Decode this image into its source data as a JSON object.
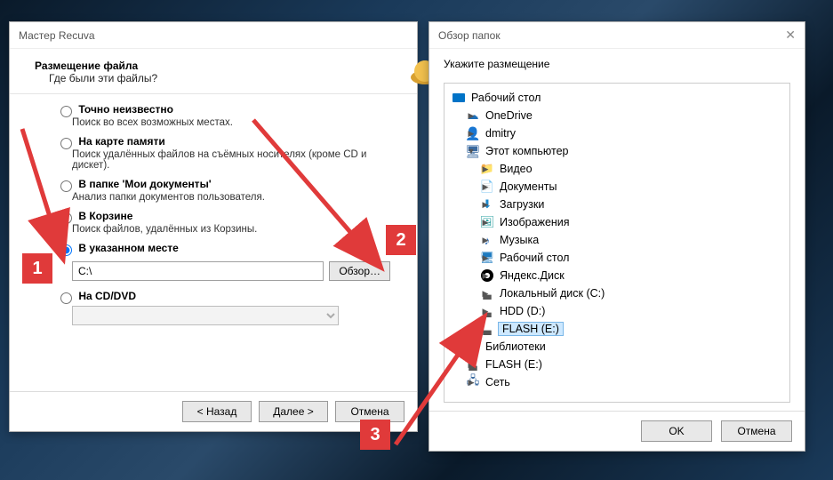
{
  "wizard": {
    "title": "Мастер Recuva",
    "head_title": "Размещение файла",
    "head_subtitle": "Где были эти файлы?",
    "options": {
      "unknown": {
        "label": "Точно неизвестно",
        "desc": "Поиск во всех возможных местах."
      },
      "card": {
        "label": "На карте памяти",
        "desc": "Поиск удалённых файлов на съёмных носителях (кроме CD и дискет)."
      },
      "mydocs": {
        "label": "В папке 'Мои документы'",
        "desc": "Анализ папки документов пользователя."
      },
      "recycle": {
        "label": "В Корзине",
        "desc": "Поиск файлов, удалённых из Корзины."
      },
      "specified": {
        "label": "В указанном месте"
      },
      "cddvd": {
        "label": "На CD/DVD"
      }
    },
    "path_value": "C:\\",
    "browse_label": "Обзор…",
    "footer": {
      "back": "< Назад",
      "next": "Далее >",
      "cancel": "Отмена"
    }
  },
  "dialog": {
    "title": "Обзор папок",
    "prompt": "Укажите размещение",
    "tree": [
      {
        "indent": 0,
        "arrow": "none",
        "icon": "desktop",
        "label": "Рабочий стол"
      },
      {
        "indent": 1,
        "arrow": "right",
        "icon": "cloud",
        "label": "OneDrive"
      },
      {
        "indent": 1,
        "arrow": "right",
        "icon": "user",
        "label": "dmitry"
      },
      {
        "indent": 1,
        "arrow": "down",
        "icon": "pc",
        "label": "Этот компьютер"
      },
      {
        "indent": 2,
        "arrow": "right",
        "icon": "folder-v",
        "label": "Видео"
      },
      {
        "indent": 2,
        "arrow": "right",
        "icon": "doc",
        "label": "Документы"
      },
      {
        "indent": 2,
        "arrow": "right",
        "icon": "down",
        "label": "Загрузки"
      },
      {
        "indent": 2,
        "arrow": "right",
        "icon": "img",
        "label": "Изображения"
      },
      {
        "indent": 2,
        "arrow": "right",
        "icon": "music",
        "label": "Музыка"
      },
      {
        "indent": 2,
        "arrow": "right",
        "icon": "deskf",
        "label": "Рабочий стол"
      },
      {
        "indent": 2,
        "arrow": "right",
        "icon": "yadisk",
        "label": "Яндекс.Диск"
      },
      {
        "indent": 2,
        "arrow": "right",
        "icon": "drive",
        "label": "Локальный диск (C:)"
      },
      {
        "indent": 2,
        "arrow": "right",
        "icon": "drive",
        "label": "HDD (D:)"
      },
      {
        "indent": 2,
        "arrow": "none",
        "icon": "drive",
        "label": "FLASH (E:)",
        "selected": true
      },
      {
        "indent": 1,
        "arrow": "right",
        "icon": "lib",
        "label": "Библиотеки"
      },
      {
        "indent": 1,
        "arrow": "right",
        "icon": "drive",
        "label": "FLASH (E:)"
      },
      {
        "indent": 1,
        "arrow": "right",
        "icon": "net",
        "label": "Сеть"
      }
    ],
    "footer": {
      "ok": "OK",
      "cancel": "Отмена"
    }
  },
  "annotations": {
    "badge1": "1",
    "badge2": "2",
    "badge3": "3"
  }
}
